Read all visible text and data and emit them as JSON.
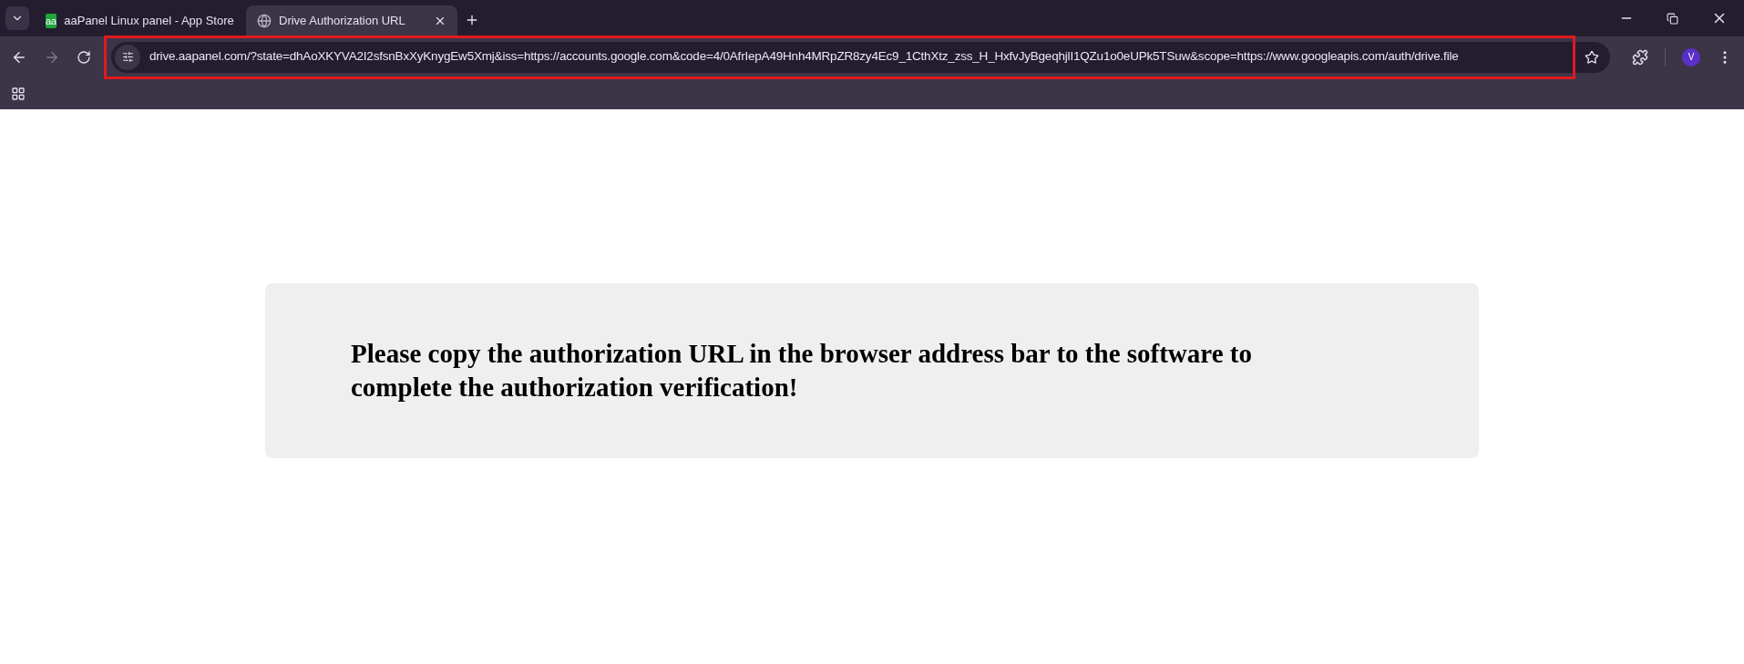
{
  "tabs": [
    {
      "title": "aaPanel Linux panel - App Store",
      "favicon": {
        "kind": "letters",
        "text": "aa"
      },
      "selected": false
    },
    {
      "title": "Drive Authorization URL",
      "favicon": {
        "kind": "globe"
      },
      "selected": true
    }
  ],
  "address_bar": {
    "url": "drive.aapanel.com/?state=dhAoXKYVA2I2sfsnBxXyKnygEw5Xmj&iss=https://accounts.google.com&code=4/0AfrIepA49Hnh4MRpZR8zy4Ec9_1CthXtz_zss_H_HxfvJyBgeqhjlI1QZu1o0eUPk5TSuw&scope=https://www.googleapis.com/auth/drive.file",
    "highlighted": true
  },
  "profile": {
    "initial": "V"
  },
  "page": {
    "message": "Please copy the authorization URL in the browser address bar to the software to complete the authorization verification!"
  }
}
